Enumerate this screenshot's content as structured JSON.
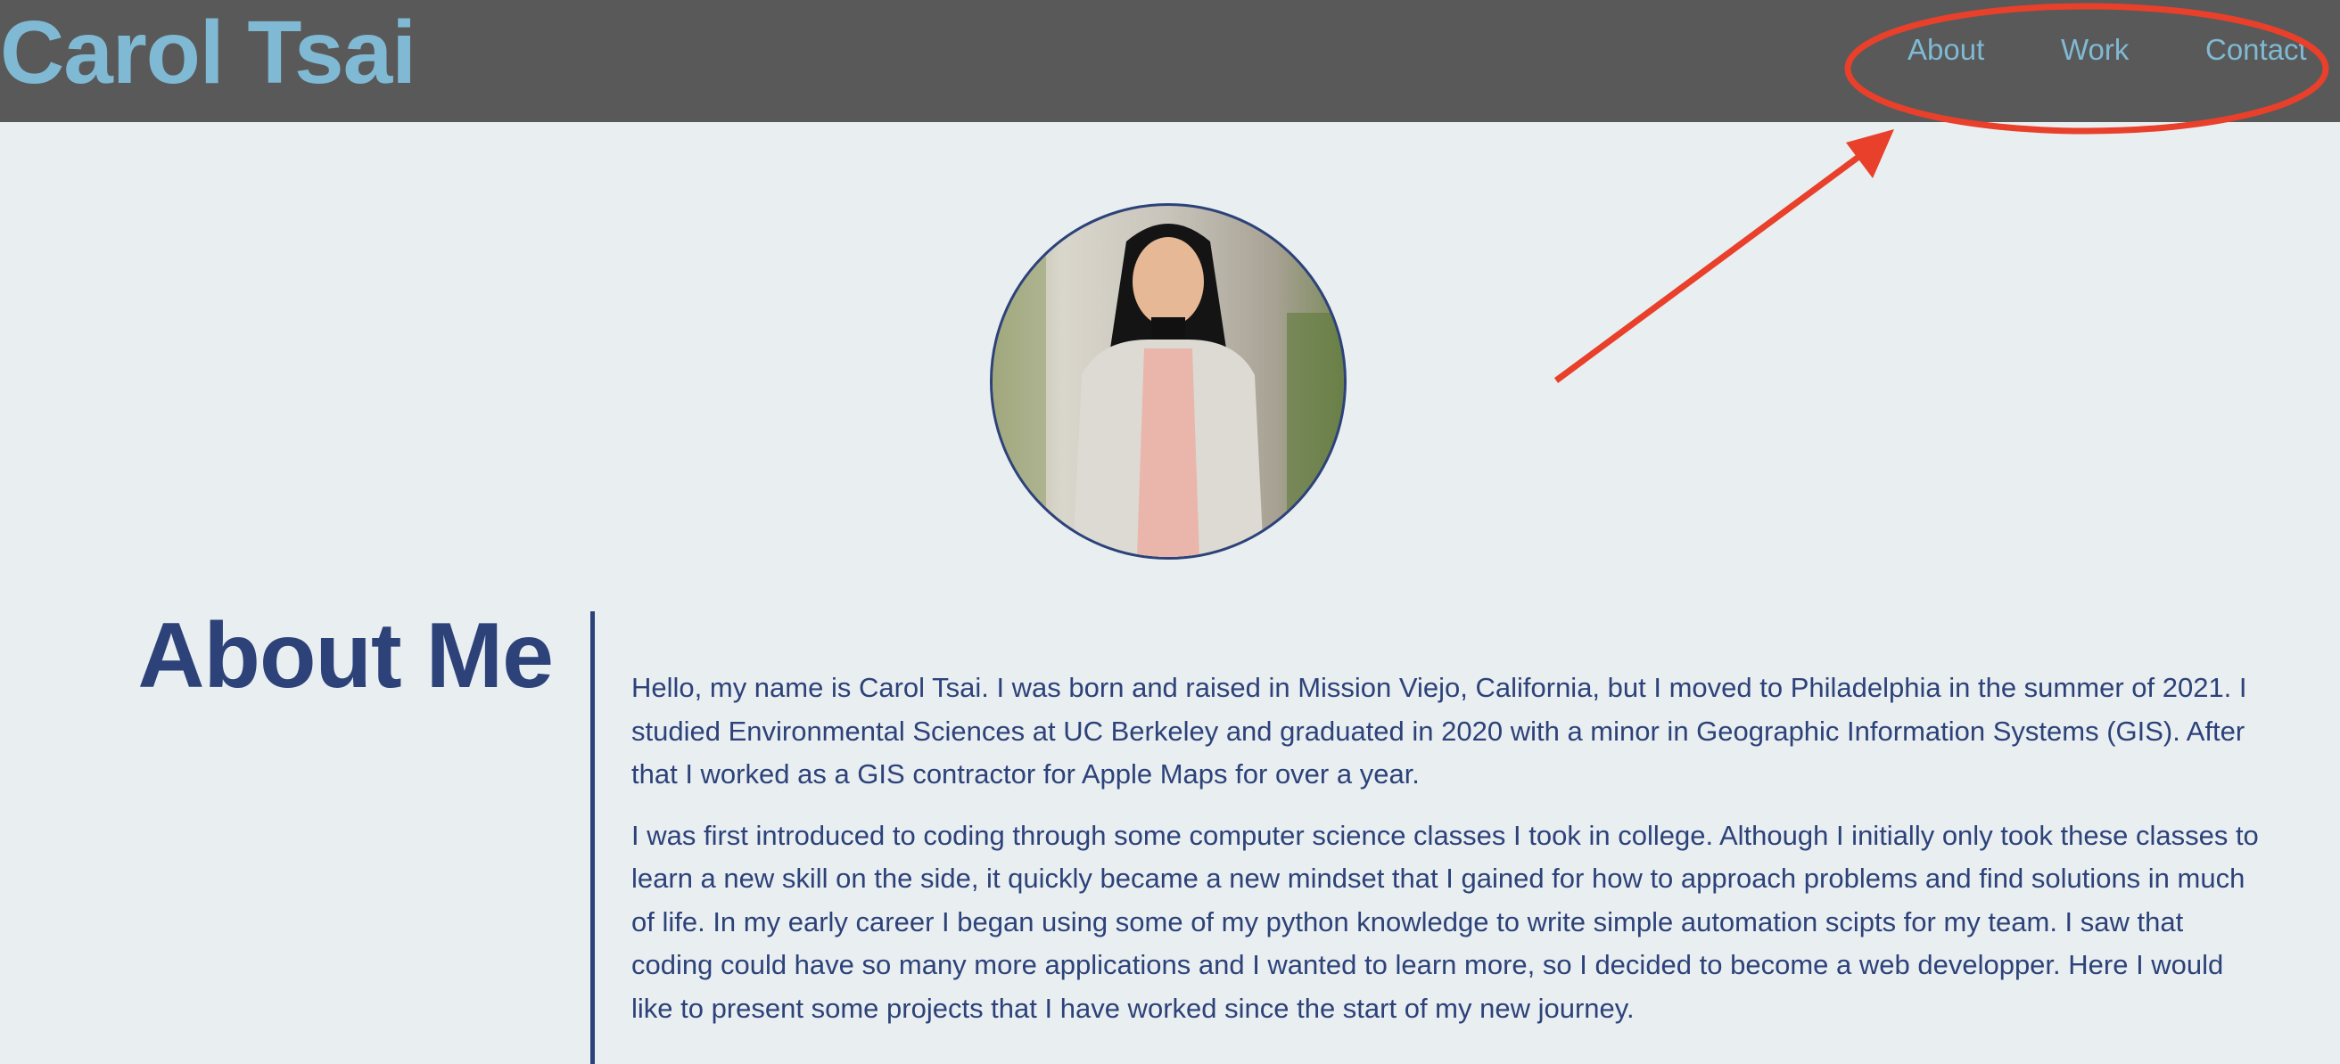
{
  "header": {
    "title": "Carol Tsai",
    "nav": [
      {
        "label": "About"
      },
      {
        "label": "Work"
      },
      {
        "label": "Contact"
      }
    ]
  },
  "about": {
    "heading": "About Me",
    "paragraphs": [
      "Hello, my name is Carol Tsai. I was born and raised in Mission Viejo, California, but I moved to Philadelphia in the summer of 2021. I studied Environmental Sciences at UC Berkeley and graduated in 2020 with a minor in Geographic Information Systems (GIS). After that I worked as a GIS contractor for Apple Maps for over a year.",
      "I was first introduced to coding through some computer science classes I took in college. Although I initially only took these classes to learn a new skill on the side, it quickly became a new mindset that I gained for how to approach problems and find solutions in much of life. In my early career I began using some of my python knowledge to write simple automation scipts for my team. I saw that coding could have so many more applications and I wanted to learn more, so I decided to become a web developper. Here I would like to present some projects that I have worked since the start of my new journey."
    ]
  },
  "colors": {
    "header_bg": "#595959",
    "title": "#7fb9d3",
    "text": "#2c4279",
    "background": "#e9eef1",
    "annotation": "#e8402a"
  }
}
